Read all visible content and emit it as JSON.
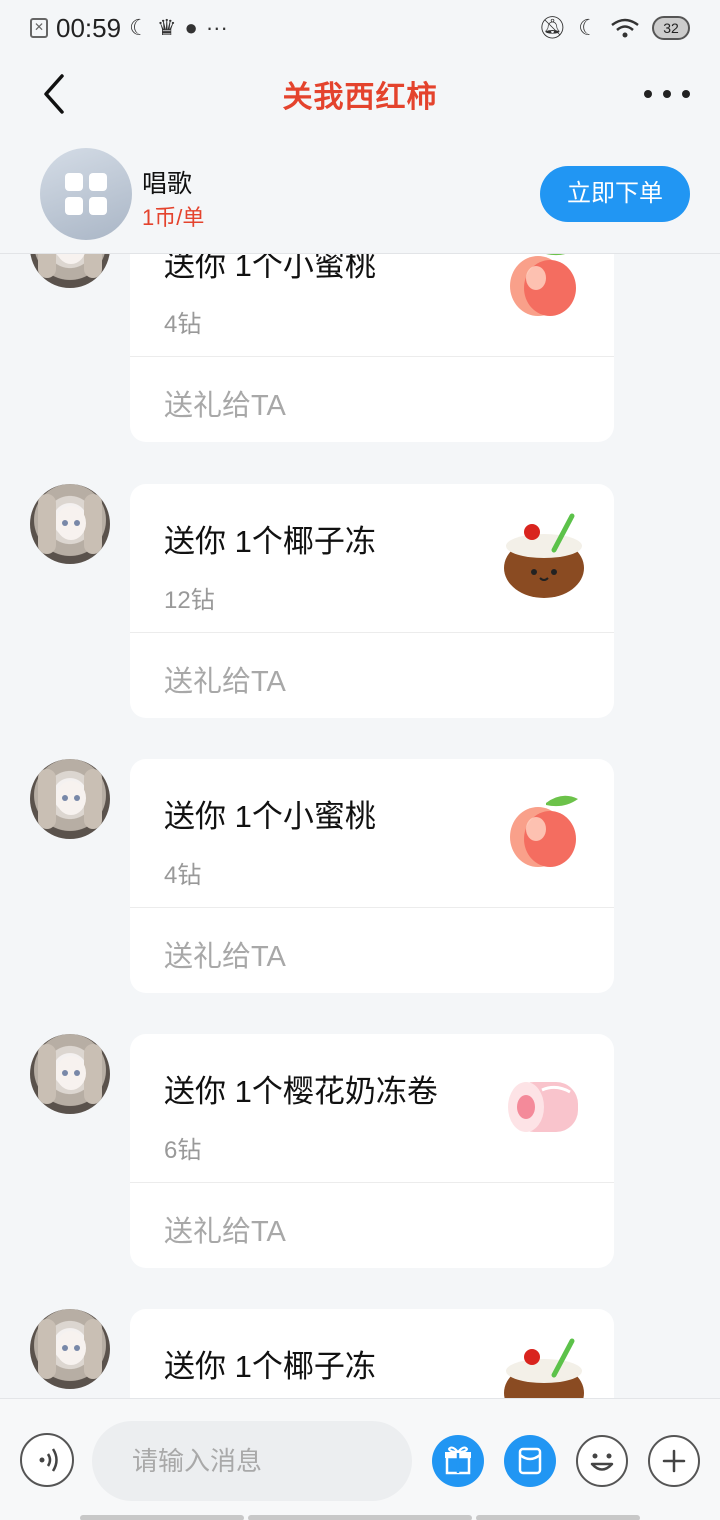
{
  "status_bar": {
    "time": "00:59",
    "notification_icon": "x-box-icon",
    "more": "···",
    "battery": "32"
  },
  "header": {
    "title": "关我西红柿"
  },
  "service": {
    "name": "唱歌",
    "price": "1币/单",
    "order_button": "立即下单"
  },
  "messages": [
    {
      "gift": "送你 1个小蜜桃",
      "cost": "4钻",
      "action": "送礼给TA",
      "gift_icon": "peach"
    },
    {
      "gift": "送你 1个椰子冻",
      "cost": "12钻",
      "action": "送礼给TA",
      "gift_icon": "coconut"
    },
    {
      "gift": "送你 1个小蜜桃",
      "cost": "4钻",
      "action": "送礼给TA",
      "gift_icon": "peach"
    },
    {
      "gift": "送你 1个樱花奶冻卷",
      "cost": "6钻",
      "action": "送礼给TA",
      "gift_icon": "sakura-roll"
    },
    {
      "gift": "送你 1个椰子冻",
      "cost": "",
      "action": "",
      "gift_icon": "coconut"
    }
  ],
  "input": {
    "placeholder": "请输入消息"
  },
  "colors": {
    "accent_red": "#e4432d",
    "accent_blue": "#2196f3"
  }
}
